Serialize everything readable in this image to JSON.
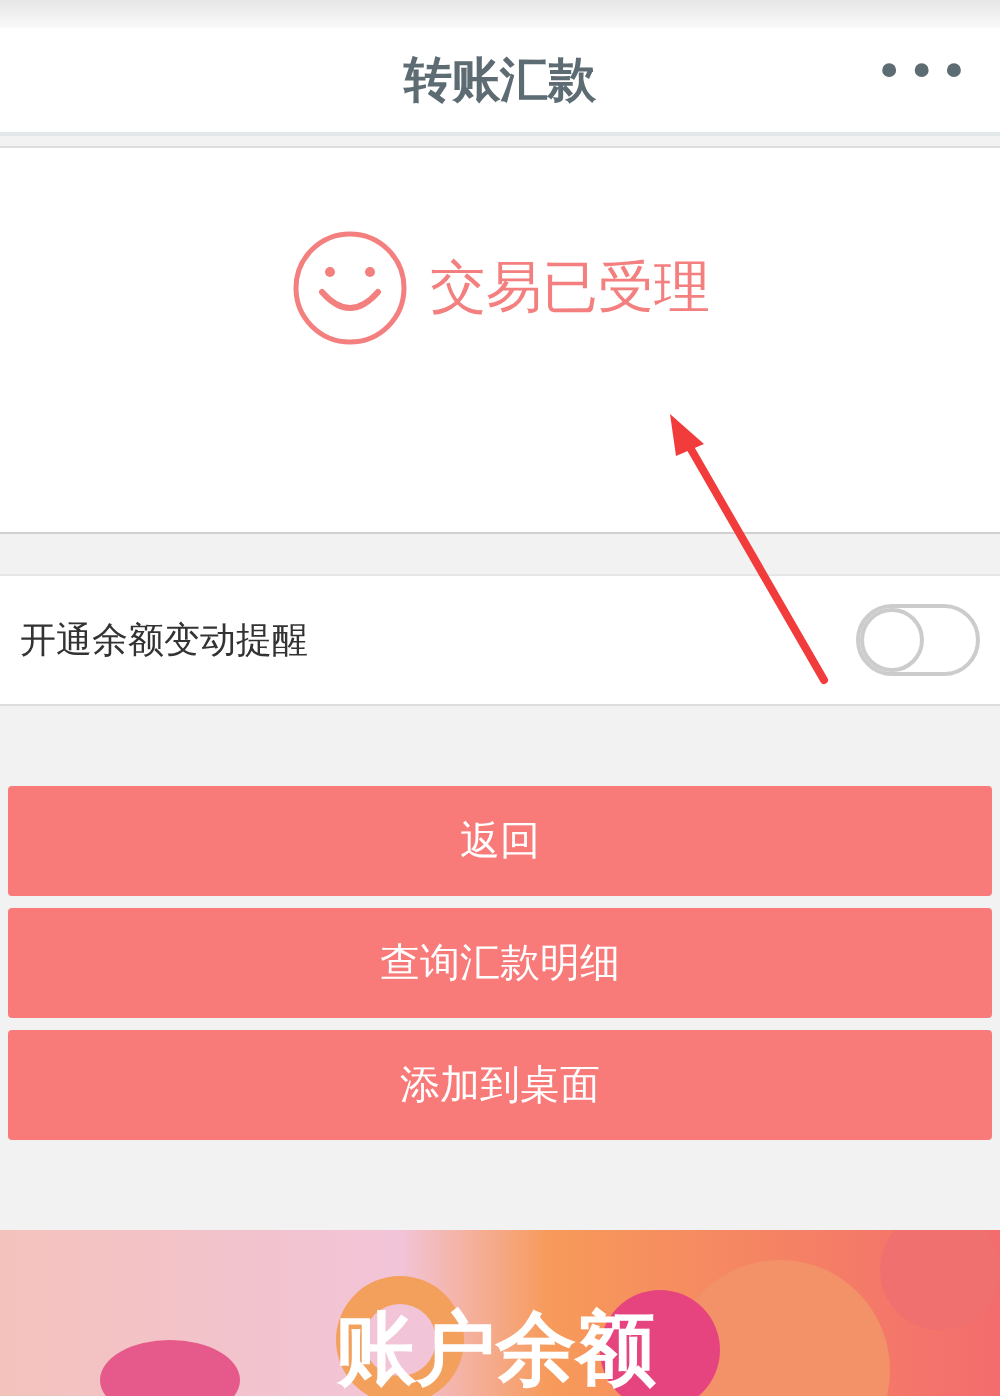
{
  "header": {
    "title": "转账汇款",
    "menu": "•••"
  },
  "status": {
    "message": "交易已受理"
  },
  "reminder": {
    "label": "开通余额变动提醒",
    "on": false
  },
  "buttons": [
    {
      "label": "返回"
    },
    {
      "label": "查询汇款明细"
    },
    {
      "label": "添加到桌面"
    }
  ],
  "banner": {
    "title": "账户余额"
  }
}
